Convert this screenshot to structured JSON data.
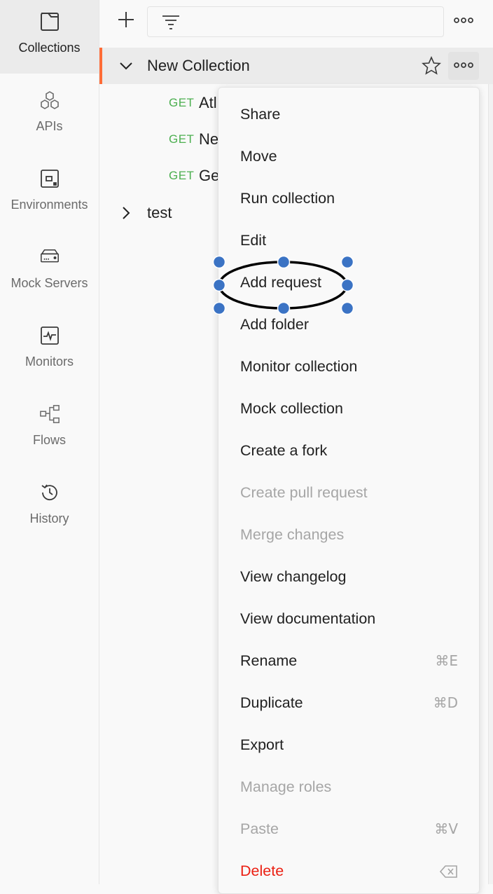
{
  "sidebar": {
    "items": [
      {
        "label": "Collections",
        "icon": "collections-icon",
        "active": true
      },
      {
        "label": "APIs",
        "icon": "apis-icon"
      },
      {
        "label": "Environments",
        "icon": "environments-icon"
      },
      {
        "label": "Mock Servers",
        "icon": "mock-servers-icon"
      },
      {
        "label": "Monitors",
        "icon": "monitors-icon"
      },
      {
        "label": "Flows",
        "icon": "flows-icon"
      },
      {
        "label": "History",
        "icon": "history-icon"
      }
    ]
  },
  "toolbar": {
    "new_icon": "plus-icon",
    "filter_icon": "filter-icon",
    "more_icon": "more-horizontal-icon"
  },
  "tree": {
    "collection": {
      "label": "New Collection",
      "expanded": true
    },
    "requests": [
      {
        "method": "GET",
        "name": "Atl"
      },
      {
        "method": "GET",
        "name": "Ne"
      },
      {
        "method": "GET",
        "name": "Ge"
      }
    ],
    "second_collection": {
      "label": "test",
      "expanded": false
    }
  },
  "menu": {
    "items": [
      {
        "label": "Share"
      },
      {
        "label": "Move"
      },
      {
        "label": "Run collection"
      },
      {
        "label": "Edit"
      },
      {
        "label": "Add request",
        "highlighted_by_annotation": true
      },
      {
        "label": "Add folder"
      },
      {
        "label": "Monitor collection"
      },
      {
        "label": "Mock collection"
      },
      {
        "label": "Create a fork"
      },
      {
        "label": "Create pull request",
        "disabled": true
      },
      {
        "label": "Merge changes",
        "disabled": true
      },
      {
        "label": "View changelog"
      },
      {
        "label": "View documentation"
      },
      {
        "label": "Rename",
        "shortcut": "⌘E"
      },
      {
        "label": "Duplicate",
        "shortcut": "⌘D"
      },
      {
        "label": "Export"
      },
      {
        "label": "Manage roles",
        "disabled": true
      },
      {
        "label": "Paste",
        "shortcut": "⌘V",
        "disabled": true
      },
      {
        "label": "Delete",
        "danger": true,
        "shortcut_icon": "backspace-icon"
      }
    ]
  },
  "colors": {
    "accent": "#ff6c37",
    "get_method": "#4caf50",
    "danger": "#eb2013",
    "annotation_handle": "#3b73c4"
  }
}
